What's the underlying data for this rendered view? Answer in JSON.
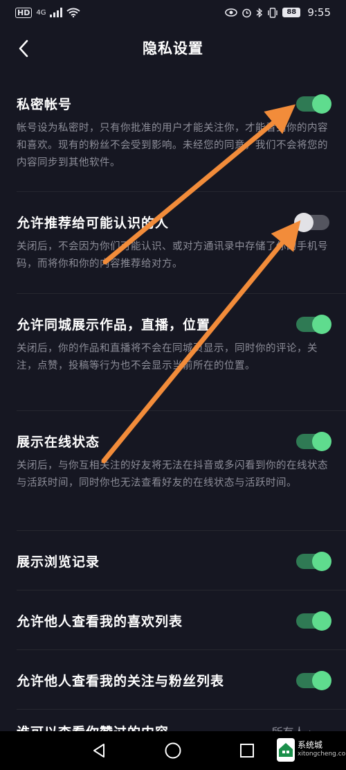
{
  "status_bar": {
    "hd": "HD",
    "signal": "4G",
    "battery": "88",
    "time": "9:55"
  },
  "header": {
    "title": "隐私设置",
    "back_icon": "chevron-left-icon"
  },
  "settings": [
    {
      "label": "私密帐号",
      "desc": "帐号设为私密时，只有你批准的用户才能关注你，才能看到你的内容和喜欢。现有的粉丝不会受到影响。未经您的同意，我们不会将您的内容同步到其他软件。",
      "toggle": "on"
    },
    {
      "label": "允许推荐给可能认识的人",
      "desc": "关闭后，不会因为你们可能认识、或对方通讯录中存储了你的手机号码，而将你和你的内容推荐给对方。",
      "toggle": "off"
    },
    {
      "label": "允许同城展示作品，直播，位置",
      "desc": "关闭后，你的作品和直播将不会在同城页显示，同时你的评论，关注，点赞，投稿等行为也不会显示当前所在的位置。",
      "toggle": "on"
    },
    {
      "label": "展示在线状态",
      "desc": "关闭后，与你互相关注的好友将无法在抖音或多闪看到你的在线状态与活跃时间，同时你也无法查看好友的在线状态与活跃时间。",
      "toggle": "on"
    },
    {
      "label": "展示浏览记录",
      "desc": "",
      "toggle": "on"
    },
    {
      "label": "允许他人查看我的喜欢列表",
      "desc": "",
      "toggle": "on"
    },
    {
      "label": "允许他人查看我的关注与粉丝列表",
      "desc": "",
      "toggle": "on"
    }
  ],
  "partial": {
    "label": "谁可以查看你赞过的内容",
    "value": "所有人 ›"
  },
  "bottom_nav": {
    "back": "triangle-back-icon",
    "home": "circle-home-icon",
    "recents": "square-recents-icon"
  },
  "watermark": {
    "brand": "系统城",
    "url": "xitongcheng.com"
  },
  "colors": {
    "background": "#161722",
    "toggle_on": "#5fdc8e",
    "arrow": "#f28c3a"
  }
}
